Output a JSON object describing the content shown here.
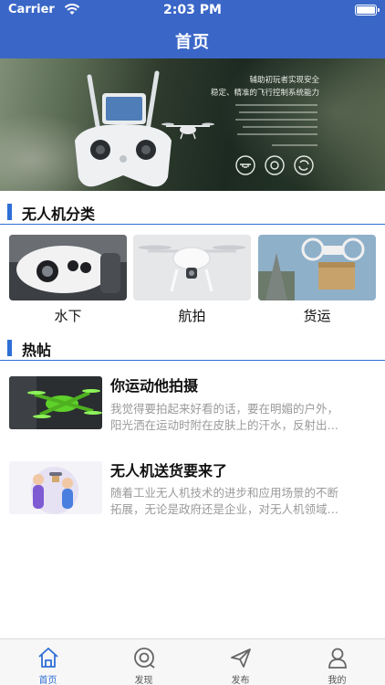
{
  "status_bar": {
    "carrier": "Carrier",
    "time": "2:03 PM"
  },
  "nav": {
    "title": "首页"
  },
  "banner": {
    "headline_1": "辅助初玩者实现安全",
    "headline_2": "稳定、精准的飞行控制系统能力",
    "icons": [
      "drone-icon",
      "target-icon",
      "refresh-icon"
    ]
  },
  "categories_section": {
    "title": "无人机分类",
    "items": [
      {
        "label": "水下"
      },
      {
        "label": "航拍"
      },
      {
        "label": "货运"
      }
    ]
  },
  "posts_section": {
    "title": "热帖",
    "items": [
      {
        "title": "你运动他拍摄",
        "line1": "我觉得要拍起来好看的话，要在明媚的户外，",
        "line2": "阳光洒在运动时附在皮肤上的汗水，反射出…"
      },
      {
        "title": "无人机送货要来了",
        "line1": "随着工业无人机技术的进步和应用场景的不断",
        "line2": "拓展，无论是政府还是企业，对无人机领域…"
      }
    ]
  },
  "tabbar": {
    "items": [
      {
        "label": "首页",
        "icon": "home-icon",
        "active": true
      },
      {
        "label": "发现",
        "icon": "discover-icon",
        "active": false
      },
      {
        "label": "发布",
        "icon": "send-icon",
        "active": false
      },
      {
        "label": "我的",
        "icon": "profile-icon",
        "active": false
      }
    ],
    "active_color": "#2f6fd6"
  },
  "colors": {
    "primary": "#3a66c7",
    "accent": "#2f6fd6"
  }
}
